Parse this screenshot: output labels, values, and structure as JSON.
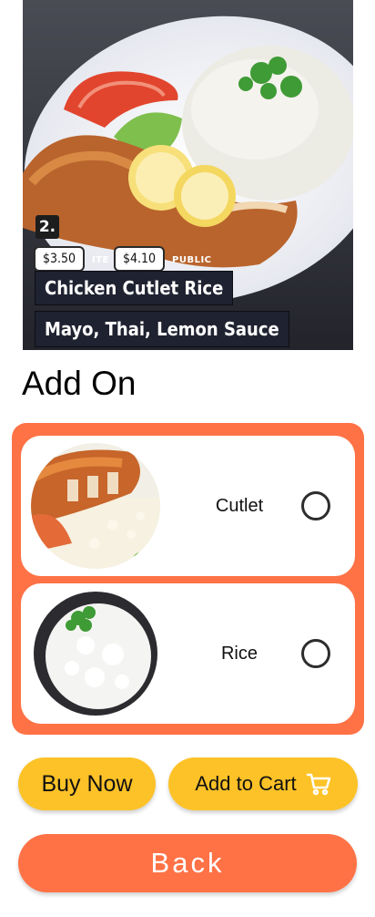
{
  "hero": {
    "number": "2.",
    "price_left": "$3.50",
    "price_left_caption": "ITE",
    "price_right": "$4.10",
    "price_right_caption": "PUBLIC",
    "dish_name": "Chicken Cutlet Rice",
    "sauces": "Mayo, Thai, Lemon Sauce"
  },
  "addon": {
    "title": "Add On",
    "items": [
      {
        "label": "Cutlet",
        "image": "chicken-cutlet-with-rice",
        "selected": false
      },
      {
        "label": "Rice",
        "image": "bowl-of-white-rice",
        "selected": false
      }
    ]
  },
  "actions": {
    "buy_now": "Buy Now",
    "add_to_cart": "Add to Cart",
    "back": "Back"
  },
  "colors": {
    "accent": "#ff7246",
    "button_yellow": "#fdc227",
    "card": "#ffffff"
  }
}
